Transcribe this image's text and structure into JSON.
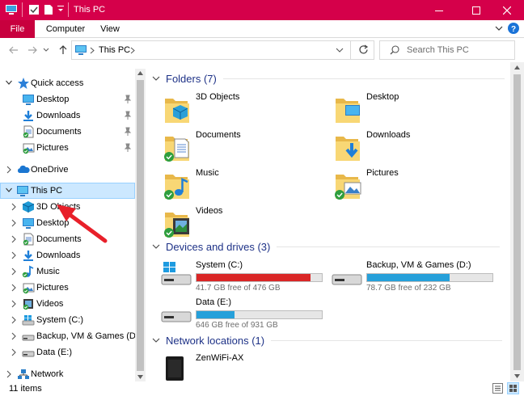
{
  "window": {
    "title": "This PC",
    "accent": "#d5004a"
  },
  "ribbon": {
    "tabs": [
      {
        "label": "File"
      },
      {
        "label": "Computer"
      },
      {
        "label": "View"
      }
    ]
  },
  "address": {
    "crumb": "This PC",
    "search_placeholder": "Search This PC"
  },
  "nav": {
    "quick_access": "Quick access",
    "quick_items": [
      {
        "label": "Desktop"
      },
      {
        "label": "Downloads"
      },
      {
        "label": "Documents"
      },
      {
        "label": "Pictures"
      }
    ],
    "onedrive": "OneDrive",
    "this_pc": "This PC",
    "pc_items": [
      {
        "label": "3D Objects"
      },
      {
        "label": "Desktop"
      },
      {
        "label": "Documents"
      },
      {
        "label": "Downloads"
      },
      {
        "label": "Music"
      },
      {
        "label": "Pictures"
      },
      {
        "label": "Videos"
      },
      {
        "label": "System (C:)"
      },
      {
        "label": "Backup, VM & Games (D:)"
      },
      {
        "label": "Data (E:)"
      }
    ],
    "network": "Network"
  },
  "content": {
    "folders_header": "Folders (7)",
    "folders": [
      {
        "label": "3D Objects"
      },
      {
        "label": "Desktop"
      },
      {
        "label": "Documents"
      },
      {
        "label": "Downloads"
      },
      {
        "label": "Music"
      },
      {
        "label": "Pictures"
      },
      {
        "label": "Videos"
      }
    ],
    "drives_header": "Devices and drives (3)",
    "drives": [
      {
        "label": "System (C:)",
        "free": "41.7 GB free of 476 GB",
        "used_fraction": 0.912,
        "bar_color": "#da2626"
      },
      {
        "label": "Backup, VM & Games (D:)",
        "free": "78.7 GB free of 232 GB",
        "used_fraction": 0.661,
        "bar_color": "#26a0da"
      },
      {
        "label": "Data (E:)",
        "free": "646 GB free of 931 GB",
        "used_fraction": 0.306,
        "bar_color": "#26a0da"
      }
    ],
    "network_header": "Network locations (1)",
    "network_items": [
      {
        "label": "ZenWiFi-AX"
      }
    ]
  },
  "status": {
    "count": "11 items"
  }
}
